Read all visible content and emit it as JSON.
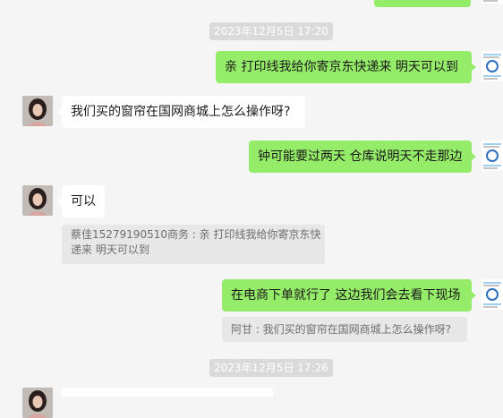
{
  "messages": {
    "top_partial": "",
    "ts1": "2023年12月5日 17:20",
    "m1": "亲 打印线我给你寄京东快递来  明天可以到",
    "m2": "我们买的窗帘在国网商城上怎么操作呀?",
    "m3": "钟可能要过两天 仓库说明天不走那边",
    "m4": "可以",
    "q4_line1": "蔡佳15279190510商务 : 亲 打印线我给你寄京东快",
    "q4_line2": "递来  明天可以到",
    "m5": "在电商下单就行了 这边我们会去看下现场",
    "q5": "阿甘 : 我们买的窗帘在国网商城上怎么操作呀?",
    "ts2": "2023年12月5日 17:26"
  },
  "colors": {
    "background": "#f5f5f5",
    "outgoing_bubble": "#95ec69",
    "incoming_bubble": "#ffffff",
    "timestamp_bg": "#dadada",
    "quote_bg": "#e7e7e7"
  }
}
